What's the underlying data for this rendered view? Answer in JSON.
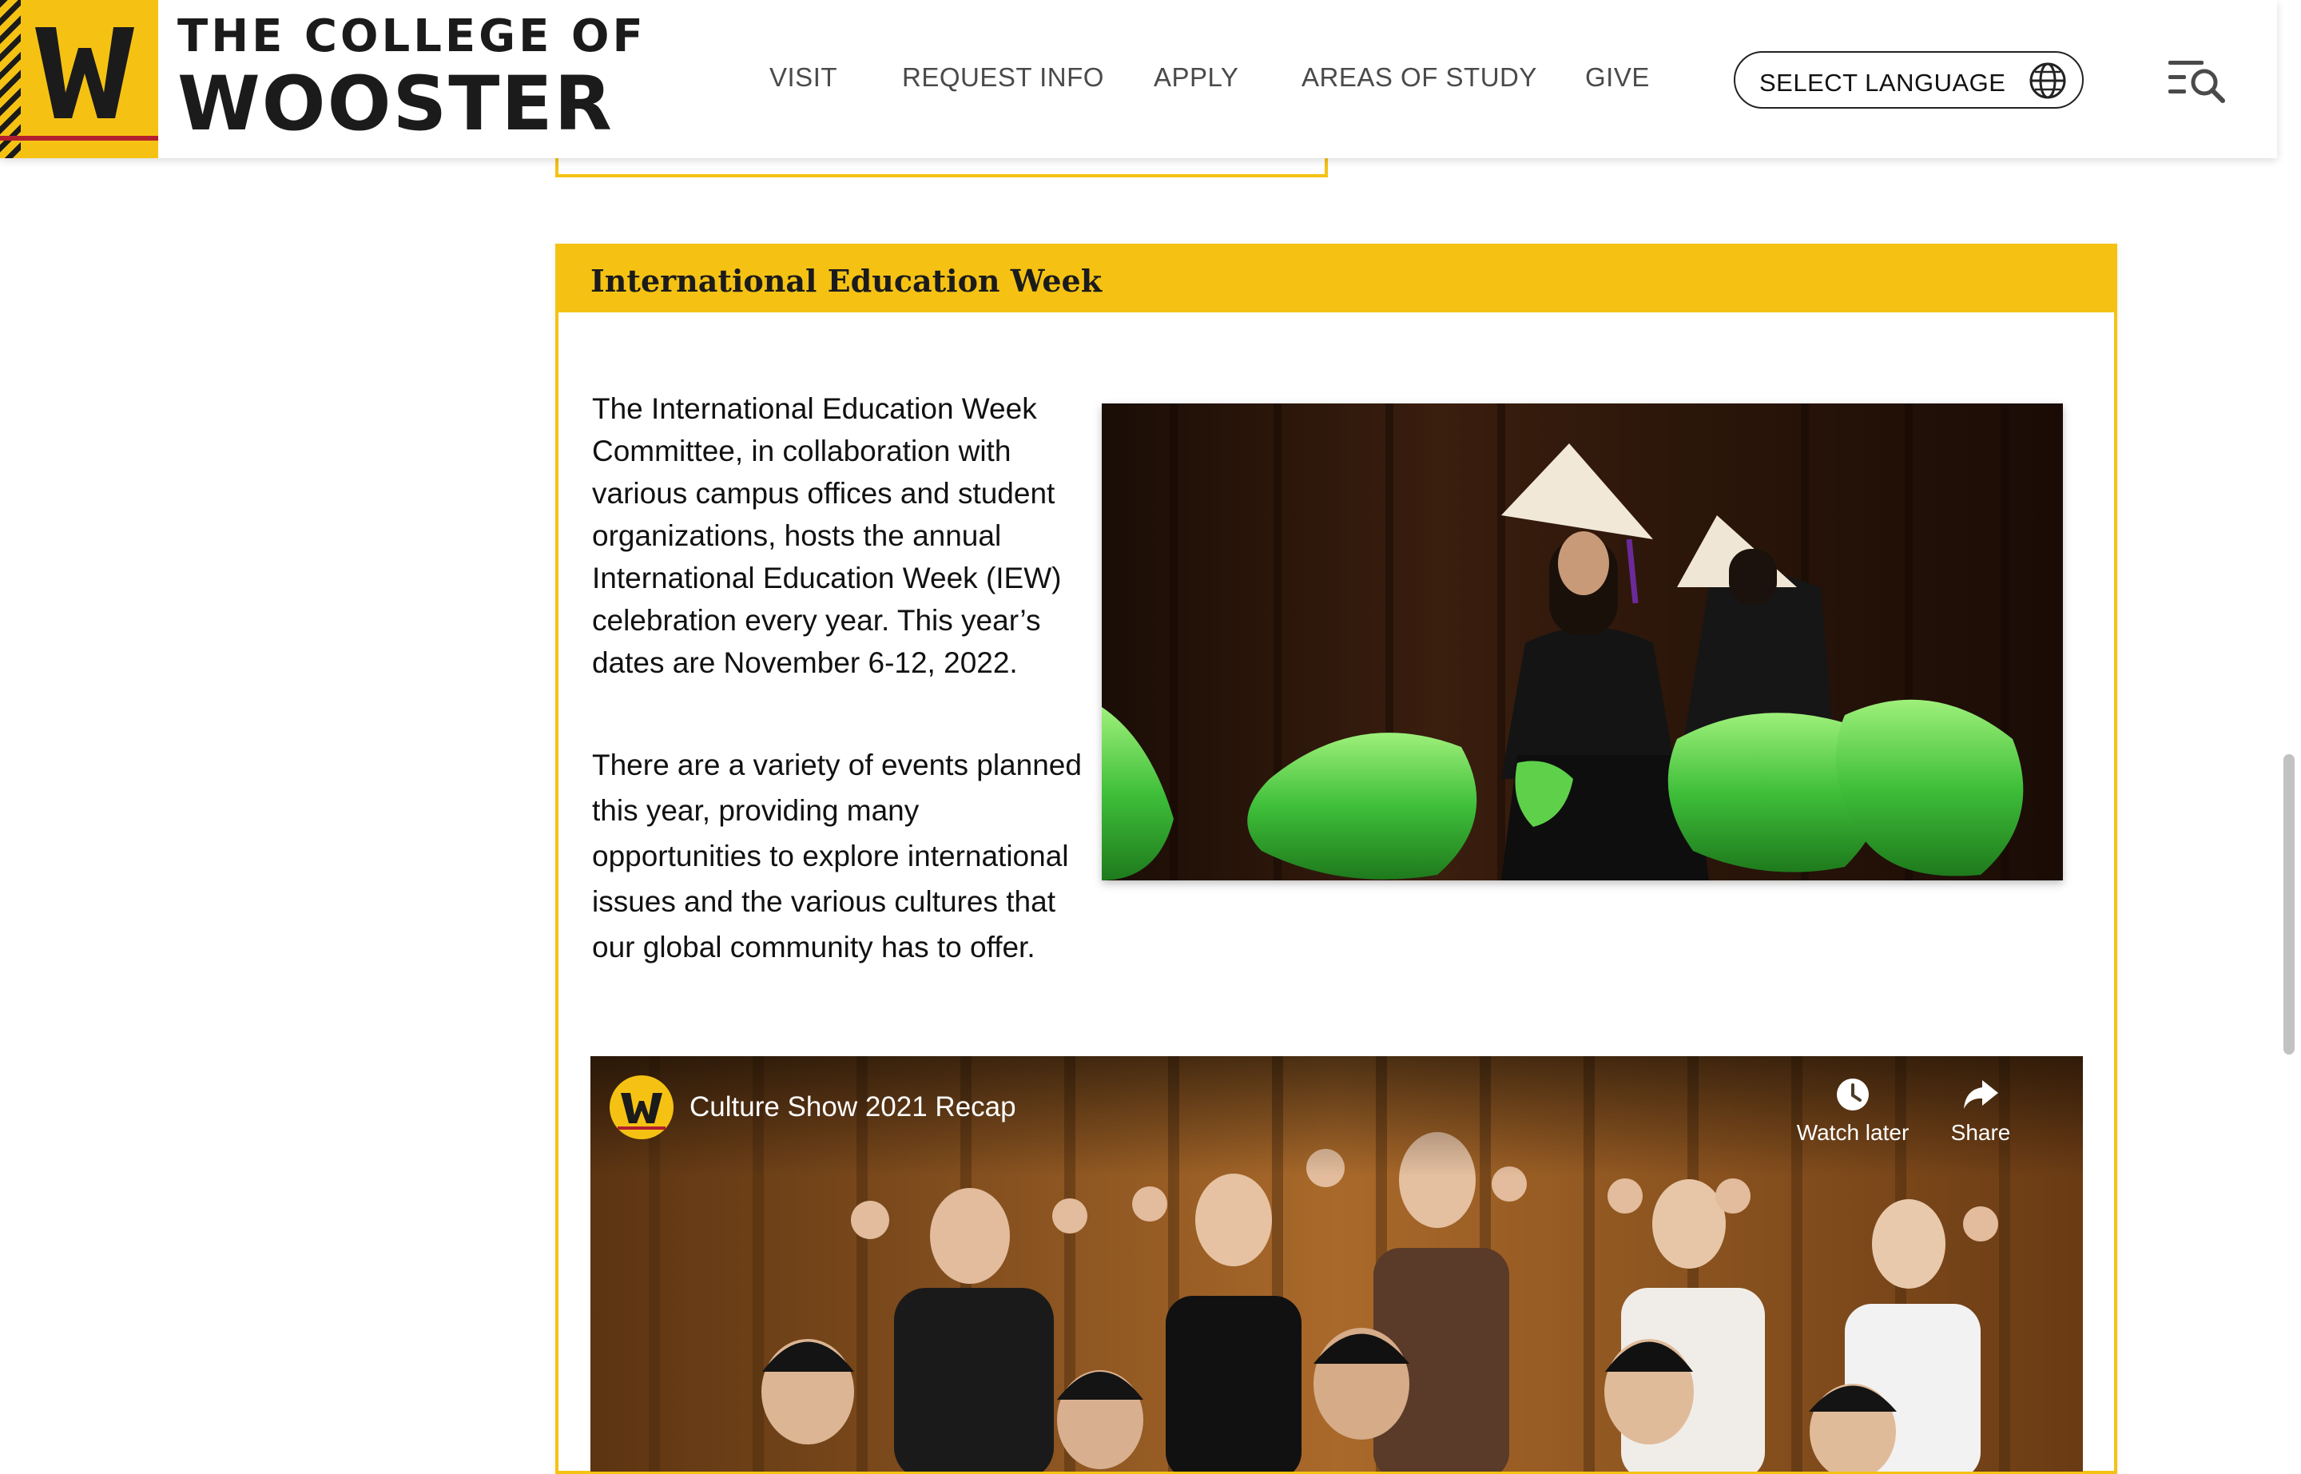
{
  "header": {
    "logo_letter": "W",
    "wordmark_top": "THE COLLEGE OF",
    "wordmark_bottom": "WOOSTER",
    "nav": [
      {
        "label": "VISIT"
      },
      {
        "label": "REQUEST INFO"
      },
      {
        "label": "APPLY"
      },
      {
        "label": "AREAS OF STUDY"
      },
      {
        "label": "GIVE"
      }
    ],
    "language_select": {
      "label": "SELECT LANGUAGE",
      "icon": "globe-icon"
    },
    "menu_icon": "menu-search-icon",
    "brand_colors": {
      "gold": "#f5c214",
      "black": "#1b1b1b",
      "red": "#b2202e"
    }
  },
  "iew_section": {
    "title": "International Education Week",
    "paragraph_1": "The International Education Week Committee, in collaboration with various campus offices and student organizations, hosts the annual International Education Week (IEW) celebration every year. This year’s dates are November 6-12, 2022.",
    "paragraph_2": "There are a variety of events planned this year, providing many opportunities to explore international issues and the various cultures that our global community has to offer.",
    "video": {
      "title": "Culture Show 2021 Recap",
      "watch_later_label": "Watch later",
      "share_label": "Share"
    }
  }
}
